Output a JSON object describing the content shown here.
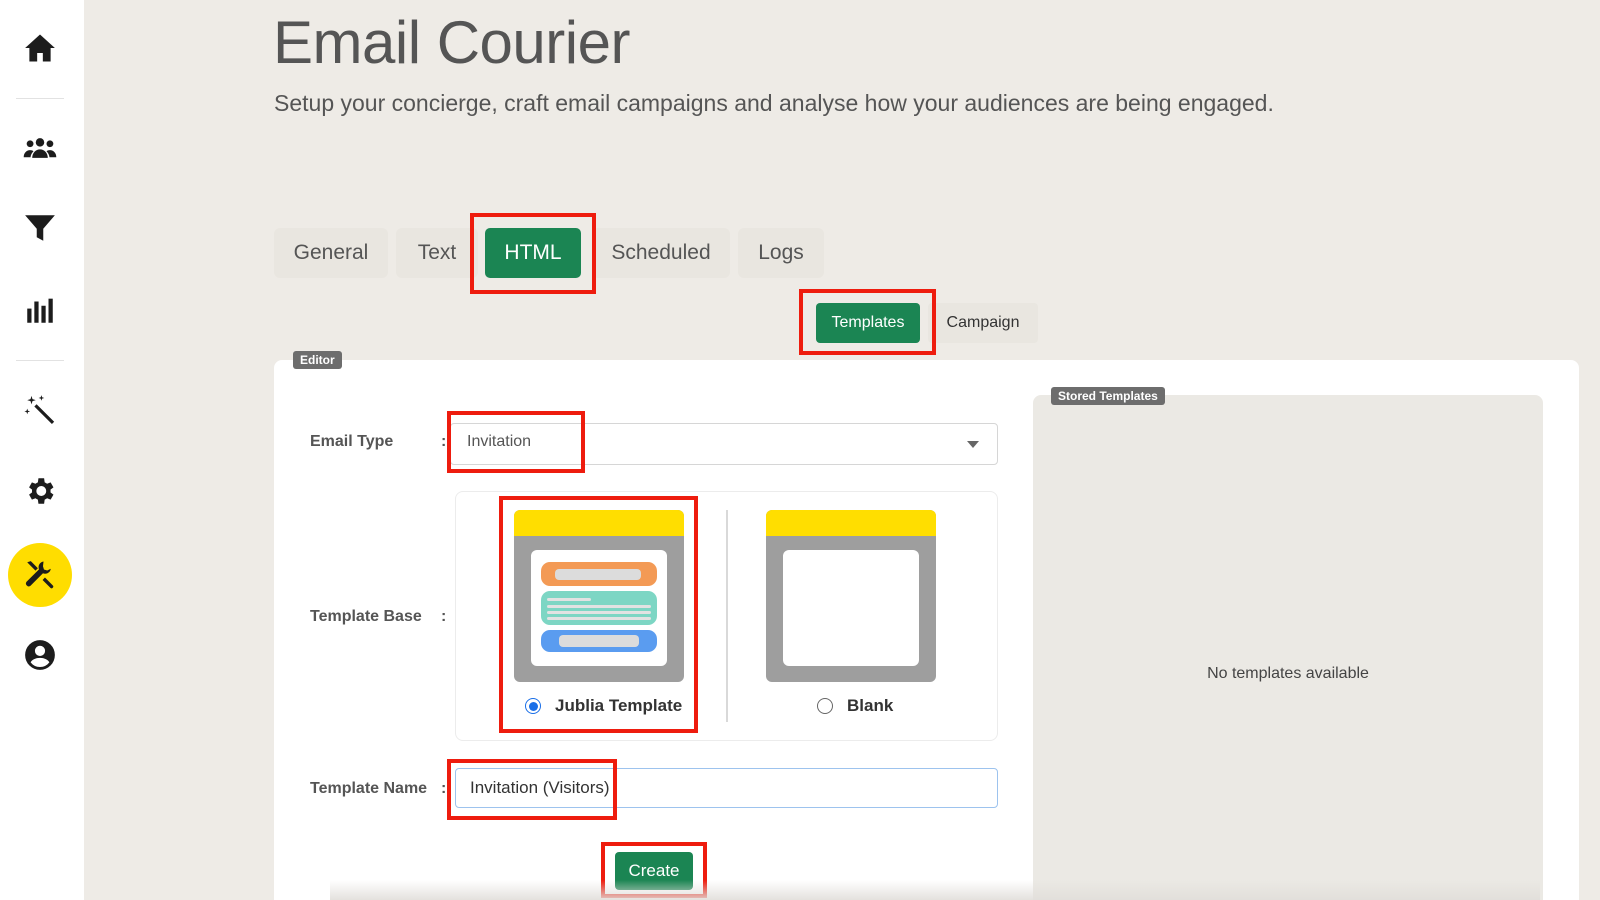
{
  "sidebar": {
    "items": [
      {
        "name": "home",
        "icon": "home-icon"
      },
      {
        "name": "audience",
        "icon": "users-icon"
      },
      {
        "name": "filter",
        "icon": "filter-icon"
      },
      {
        "name": "analytics",
        "icon": "bar-chart-icon"
      },
      {
        "name": "magic",
        "icon": "magic-wand-icon"
      },
      {
        "name": "settings",
        "icon": "gear-icon"
      },
      {
        "name": "tools",
        "icon": "tools-icon",
        "active": true
      },
      {
        "name": "account",
        "icon": "user-circle-icon"
      }
    ]
  },
  "header": {
    "title": "Email Courier",
    "subtitle": "Setup your concierge, craft email campaigns and analyse how your audiences are being engaged."
  },
  "tabs": [
    "General",
    "Text",
    "HTML",
    "Scheduled",
    "Logs"
  ],
  "active_tab": "HTML",
  "subtabs": [
    "Templates",
    "Campaign"
  ],
  "active_subtab": "Templates",
  "editor": {
    "badge": "Editor",
    "email_type_label": "Email Type",
    "email_type_value": "Invitation",
    "template_base_label": "Template Base",
    "template_options": [
      {
        "label": "Jublia Template",
        "selected": true
      },
      {
        "label": "Blank",
        "selected": false
      }
    ],
    "template_name_label": "Template Name",
    "template_name_value": "Invitation (Visitors)",
    "create_label": "Create",
    "colon": ":"
  },
  "stored_templates": {
    "badge": "Stored Templates",
    "empty_text": "No templates available"
  },
  "colors": {
    "accent_green": "#1b8553",
    "highlight_red": "#ee1c0e",
    "active_nav_yellow": "#ffdd00"
  }
}
